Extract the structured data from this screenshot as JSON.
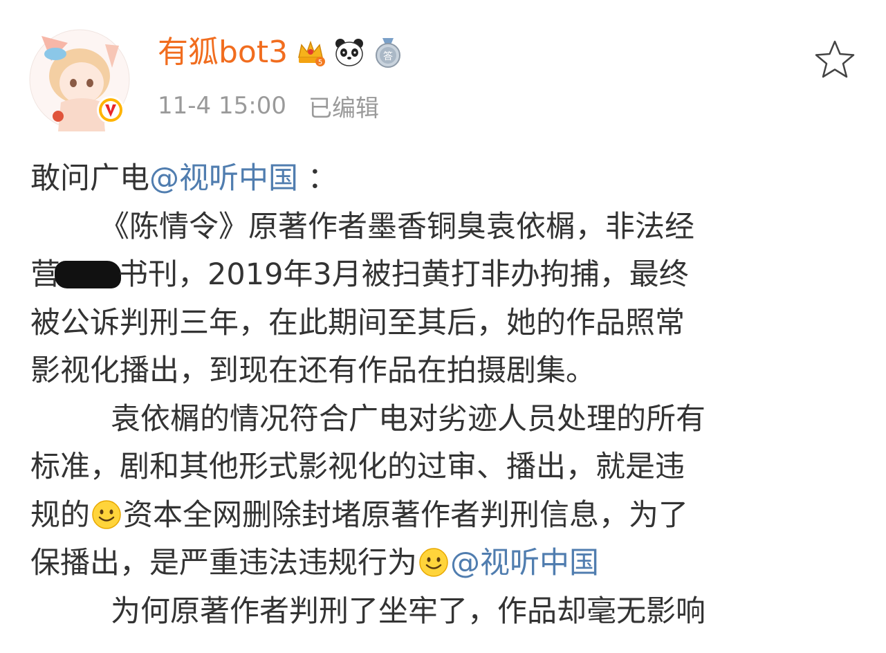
{
  "header": {
    "username": "有狐bot3",
    "timestamp": "11-4 15:00",
    "edited_label": "已编辑",
    "badges": [
      "crown-level-icon",
      "panda-icon",
      "answer-medal-icon"
    ],
    "verified_icon": "verified-v-icon",
    "favorite_icon": "star-outline-icon"
  },
  "post": {
    "line1": {
      "text": "敢问广电",
      "mention": "@视听中国",
      "tail": " ："
    },
    "line2": {
      "text": "《陈情令》原著作者墨香铜臭袁依榍，非法经"
    },
    "line3": {
      "before": "营",
      "after": "书刊，2019年3月被扫黄打非办拘捕，最终"
    },
    "line4": {
      "text": "被公诉判刑三年，在此期间至其后，她的作品照常"
    },
    "line5": {
      "text": "影视化播出，到现在还有作品在拍摄剧集。"
    },
    "line6": {
      "text": "袁依榍的情况符合广电对劣迹人员处理的所有"
    },
    "line7": {
      "text": "标准，剧和其他形式影视化的过审、播出，就是违"
    },
    "line8": {
      "before": "规的",
      "after": "资本全网删除封堵原著作者判刑信息，为了"
    },
    "line9": {
      "text": "保播出，是严重违法违规行为",
      "mention": "@视听中国"
    },
    "line10": {
      "text": "为何原著作者判刑了坐牢了，作品却毫无影响"
    }
  },
  "colors": {
    "username": "#f16d1f",
    "mention": "#507daf",
    "body_text": "#333333",
    "meta_text": "#9a9a9a",
    "verified": "#ffb400"
  }
}
